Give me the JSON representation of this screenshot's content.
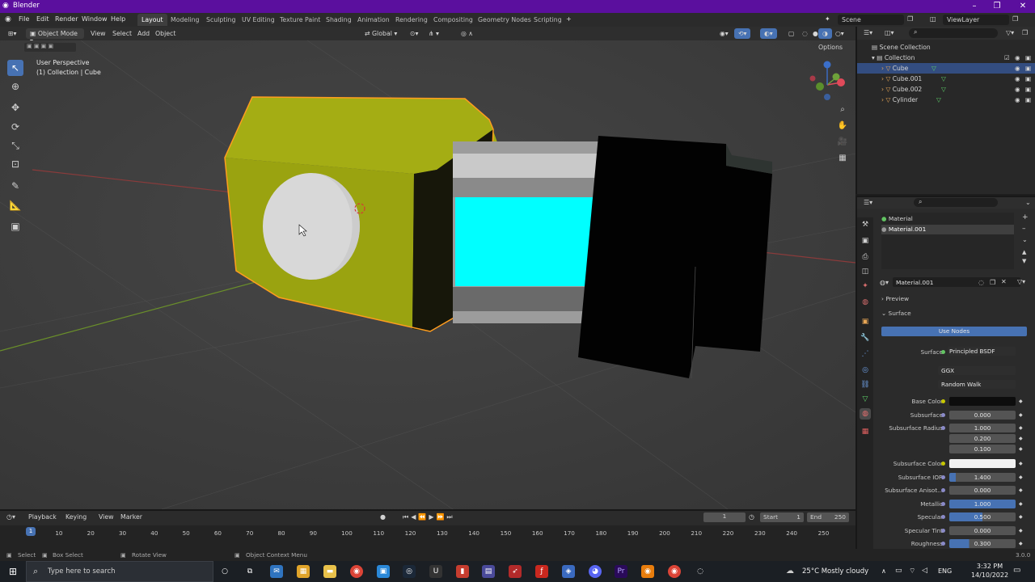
{
  "app": {
    "title": "Blender"
  },
  "menu": [
    "File",
    "Edit",
    "Render",
    "Window",
    "Help"
  ],
  "workspaces": [
    "Layout",
    "Modeling",
    "Sculpting",
    "UV Editing",
    "Texture Paint",
    "Shading",
    "Animation",
    "Rendering",
    "Compositing",
    "Geometry Nodes",
    "Scripting"
  ],
  "scene": {
    "label": "Scene",
    "view_layer": "ViewLayer"
  },
  "viewport_header": {
    "mode": "Object Mode",
    "view": "View",
    "select": "Select",
    "add": "Add",
    "object": "Object",
    "orientation": "Global",
    "options": "Options"
  },
  "viewport": {
    "perspective": "User Perspective",
    "collection": "(1) Collection | Cube"
  },
  "outliner": {
    "scene_collection": "Scene Collection",
    "collection": "Collection",
    "items": [
      "Cube",
      "Cube.001",
      "Cube.002",
      "Cylinder"
    ]
  },
  "properties": {
    "slots": [
      "Material",
      "Material.001"
    ],
    "material_name": "Material.001",
    "preview": "Preview",
    "surface_panel": "Surface",
    "use_nodes": "Use Nodes",
    "surface_label": "Surface",
    "surface_value": "Principled BSDF",
    "distribution": "GGX",
    "subsurface_method": "Random Walk",
    "rows": [
      {
        "label": "Base Color",
        "value": ""
      },
      {
        "label": "Subsurface",
        "value": "0.000"
      },
      {
        "label": "Subsurface Radius",
        "value": "1.000"
      },
      {
        "label": "",
        "value": "0.200"
      },
      {
        "label": "",
        "value": "0.100"
      },
      {
        "label": "Subsurface Color",
        "value": ""
      },
      {
        "label": "Subsurface IOR",
        "value": "1.400"
      },
      {
        "label": "Subsurface Anisot...",
        "value": "0.000"
      },
      {
        "label": "Metallic",
        "value": "1.000"
      },
      {
        "label": "Specular",
        "value": "0.500"
      },
      {
        "label": "Specular Tint",
        "value": "0.000"
      },
      {
        "label": "Roughness",
        "value": "0.300"
      }
    ]
  },
  "timeline": {
    "playback": "Playback",
    "keying": "Keying",
    "view": "View",
    "marker": "Marker",
    "current": "1",
    "start_label": "Start",
    "start": "1",
    "end_label": "End",
    "end": "250",
    "ticks": [
      "10",
      "20",
      "30",
      "40",
      "50",
      "60",
      "70",
      "80",
      "90",
      "100",
      "110",
      "120",
      "130",
      "140",
      "150",
      "160",
      "170",
      "180",
      "190",
      "200",
      "210",
      "220",
      "230",
      "240",
      "250"
    ],
    "current_frame_marker": "1"
  },
  "status": {
    "select": "Select",
    "box_select": "Box Select",
    "rotate_view": "Rotate View",
    "context_menu": "Object Context Menu",
    "version": "3.0.0"
  },
  "taskbar": {
    "search_placeholder": "Type here to search",
    "weather": "25°C  Mostly cloudy",
    "lang": "ENG",
    "time": "3:32 PM",
    "date": "14/10/2022"
  },
  "colors": {
    "accent": "#4772b3",
    "title_bar": "#5b0f9e",
    "yellow_body": "#b5bf1a",
    "cyan": "#00ffff"
  }
}
